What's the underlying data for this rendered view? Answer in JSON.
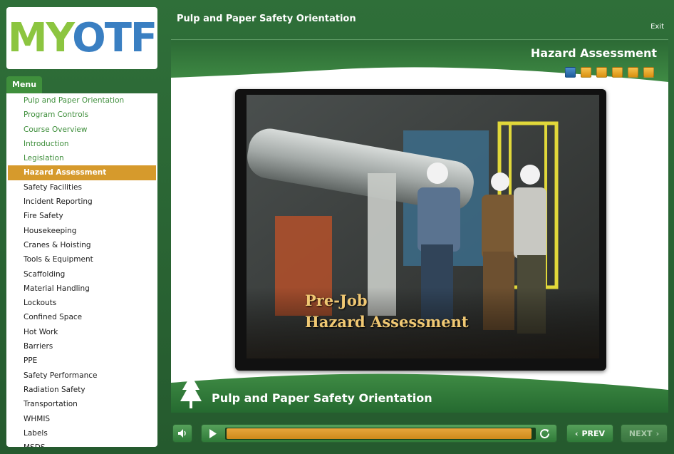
{
  "logo": {
    "text_m": "M",
    "text_y": "Y",
    "text_otf": "OTF"
  },
  "menu": {
    "tab_label": "Menu",
    "items": [
      {
        "label": "Pulp and Paper Orientation",
        "state": "visited"
      },
      {
        "label": "Program Controls",
        "state": "visited"
      },
      {
        "label": "Course Overview",
        "state": "visited"
      },
      {
        "label": "Introduction",
        "state": "visited"
      },
      {
        "label": "Legislation",
        "state": "visited"
      },
      {
        "label": "Hazard Assessment",
        "state": "active"
      },
      {
        "label": "Safety Facilities",
        "state": "normal"
      },
      {
        "label": "Incident Reporting",
        "state": "normal"
      },
      {
        "label": "Fire Safety",
        "state": "normal"
      },
      {
        "label": "Housekeeping",
        "state": "normal"
      },
      {
        "label": "Cranes & Hoisting",
        "state": "normal"
      },
      {
        "label": "Tools & Equipment",
        "state": "normal"
      },
      {
        "label": "Scaffolding",
        "state": "normal"
      },
      {
        "label": "Material Handling",
        "state": "normal"
      },
      {
        "label": "Lockouts",
        "state": "normal"
      },
      {
        "label": "Confined Space",
        "state": "normal"
      },
      {
        "label": "Hot Work",
        "state": "normal"
      },
      {
        "label": "Barriers",
        "state": "normal"
      },
      {
        "label": "PPE",
        "state": "normal"
      },
      {
        "label": "Safety Performance",
        "state": "normal"
      },
      {
        "label": "Radiation Safety",
        "state": "normal"
      },
      {
        "label": "Transportation",
        "state": "normal"
      },
      {
        "label": "WHMIS",
        "state": "normal"
      },
      {
        "label": "Labels",
        "state": "normal"
      },
      {
        "label": "MSDS",
        "state": "normal"
      }
    ]
  },
  "header": {
    "course_title": "Pulp and Paper Safety Orientation",
    "exit_label": "Exit"
  },
  "content": {
    "section_title": "Hazard Assessment",
    "progress": {
      "total": 6,
      "current": 1
    },
    "video_caption_line1": "Pre-Job",
    "video_caption_line2": "Hazard Assessment",
    "footer_title": "Pulp and Paper Safety Orientation"
  },
  "controls": {
    "playback_progress": 0.99,
    "prev_label": "PREV",
    "next_label": "NEXT"
  },
  "colors": {
    "accent": "#d69a2c",
    "brand_green": "#2f6f39",
    "visited": "#3f8f3c"
  }
}
